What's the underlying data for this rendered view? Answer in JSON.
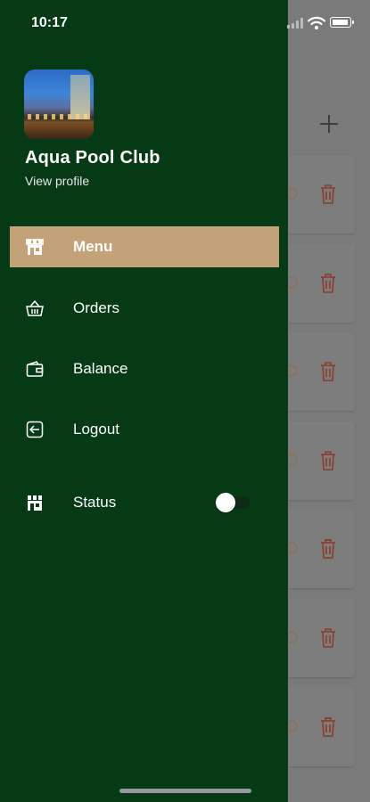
{
  "status_bar": {
    "time": "10:17",
    "icons": [
      "signal-icon",
      "wifi-icon",
      "battery-icon"
    ]
  },
  "profile": {
    "name": "Aqua Pool Club",
    "view_profile": "View profile",
    "avatar": "venue-photo"
  },
  "menu": {
    "items": [
      {
        "label": "Menu",
        "icon": "store-icon",
        "active": true
      },
      {
        "label": "Orders",
        "icon": "basket-icon",
        "active": false
      },
      {
        "label": "Balance",
        "icon": "wallet-icon",
        "active": false
      },
      {
        "label": "Logout",
        "icon": "logout-icon",
        "active": false
      }
    ],
    "status": {
      "label": "Status",
      "icon": "store-icon",
      "enabled": false
    }
  },
  "background_screen": {
    "add_icon": "plus-icon",
    "card_icons": [
      "edit-icon",
      "trash-icon"
    ],
    "card_count": 7
  },
  "colors": {
    "drawer": "#063a17",
    "active_item": "#c3a27a",
    "overlay": "#7a7a7a",
    "trash": "#8a3b2a"
  }
}
